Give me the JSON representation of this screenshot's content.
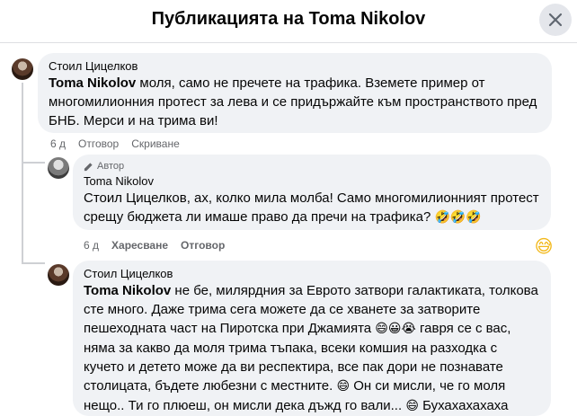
{
  "header": {
    "title": "Публикацията на Toma Nikolov"
  },
  "comments": [
    {
      "author": "Стоил Цицелков",
      "mention": "Toma Nikolov",
      "text": " моля, само не пречете на трафика. Вземете пример от многомилионния протест за лева и се придържайте към пространството пред БНБ. Мерси и на трима ви!",
      "time": "6 д",
      "actions": [
        "Отговор",
        "Скриване"
      ]
    },
    {
      "badge": "Автор",
      "author": "Toma Nikolov",
      "text": "Стоил Цицелков, ах, колко мила молба! Само многомилионният протест срещу бюджета ли имаше право да пречи на трафика?",
      "emojis": "🤣🤣🤣",
      "time": "6 д",
      "actions": [
        "Харесване",
        "Отговор"
      ],
      "reaction_icon": "grinning-sweat-emoji"
    },
    {
      "author": "Стоил Цицелков",
      "mention": "Toma Nikolov",
      "text_1": " не бе, милярдния за Еврото затвори галактиката, толкова сте много. Даже трима сега можете да се хванете за затворите пешеходната част на Пиротска при Джамията ",
      "emoji_1": "😄😀😭",
      "text_2": " гавря се с вас, няма за какво да моля трима тъпака, всеки комшия на разходка с кучето и детето може да ви респектира, все пак дори не познавате столицата, бъдете любезни с местните. ",
      "emoji_2": "😄",
      "text_3": " Он си мисли, че го моля нещо.. Ти го плюеш, он мисли дека дъжд го вали... ",
      "emoji_3": "😄",
      "text_4": " Бухахахахаха"
    }
  ],
  "colors": {
    "bubble": "#f0f2f5",
    "meta": "#65676b",
    "text": "#050505"
  }
}
